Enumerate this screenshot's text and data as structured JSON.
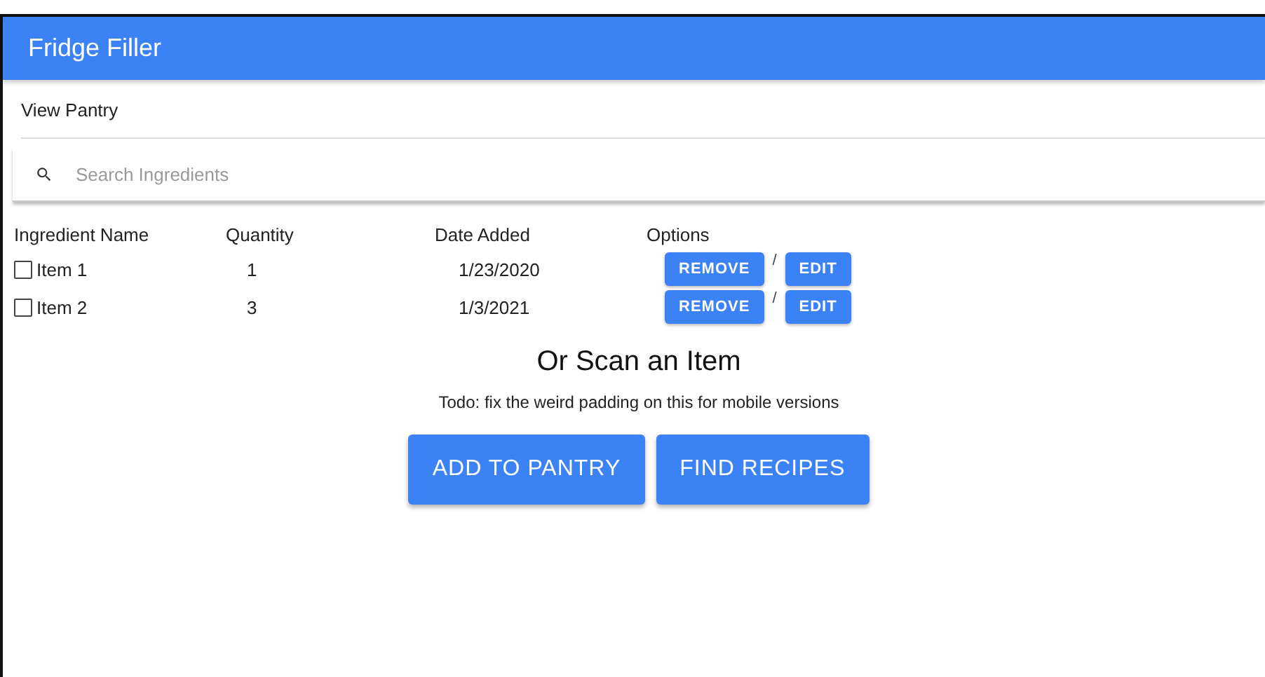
{
  "app_bar": {
    "title": "Fridge Filler"
  },
  "section_title": "View Pantry",
  "search": {
    "placeholder": "Search Ingredients"
  },
  "table": {
    "columns": [
      "Ingredient Name",
      "Quantity",
      "Date Added",
      "Options"
    ],
    "rows": [
      {
        "name": "Item 1",
        "quantity": "1",
        "date": "1/23/2020",
        "checked": false,
        "remove": "REMOVE",
        "separator": "/",
        "edit": "EDIT"
      },
      {
        "name": "Item 2",
        "quantity": "3",
        "date": "1/3/2021",
        "checked": false,
        "remove": "REMOVE",
        "separator": "/",
        "edit": "EDIT"
      }
    ]
  },
  "scan": {
    "heading": "Or Scan an Item",
    "note": "Todo: fix the weird padding on this for mobile versions"
  },
  "actions": [
    "ADD TO PANTRY",
    "FIND RECIPES"
  ]
}
